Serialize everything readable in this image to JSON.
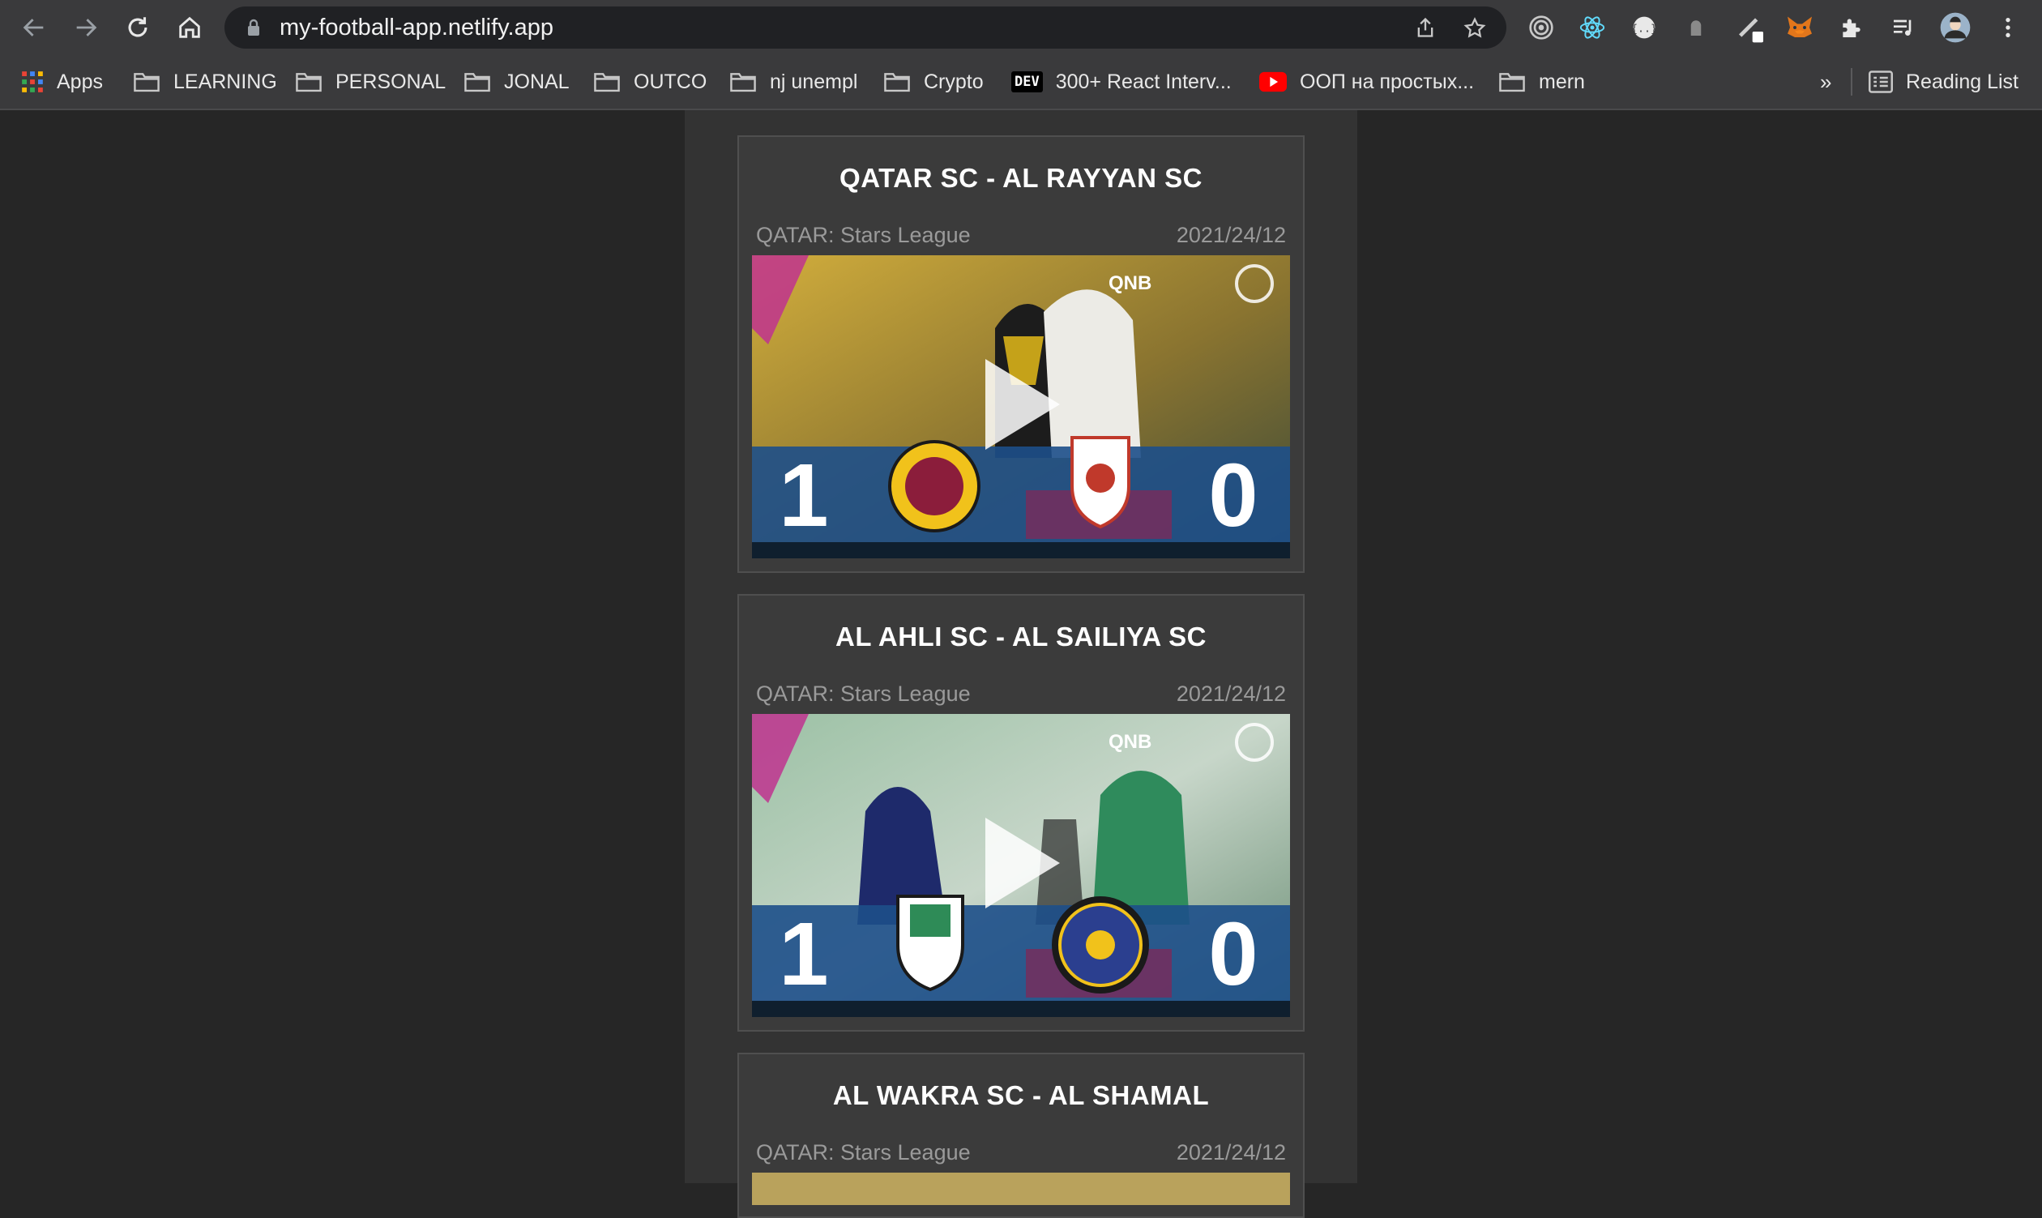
{
  "browser": {
    "url": "my-football-app.netlify.app",
    "bookmarks": [
      "Apps",
      "LEARNING",
      "PERSONAL",
      "JONAL",
      "OUTCO",
      "nj unempl",
      "Crypto",
      "300+ React Interv...",
      "ООП на простых...",
      "mern"
    ],
    "overflow": "»",
    "reading_list": "Reading List",
    "dev_badge": "DEV"
  },
  "matches": [
    {
      "title": "QATAR SC - AL RAYYAN SC",
      "league": "QATAR: Stars League",
      "date": "2021/24/12",
      "home_score": "1",
      "away_score": "0",
      "sponsor": "QNB",
      "bg_colors": [
        "#b8962a",
        "#e6e0d2"
      ]
    },
    {
      "title": "AL AHLI SC - AL SAILIYA SC",
      "league": "QATAR: Stars League",
      "date": "2021/24/12",
      "home_score": "1",
      "away_score": "0",
      "sponsor": "QNB",
      "bg_colors": [
        "#7fa98c",
        "#c9d9cc"
      ]
    },
    {
      "title": "AL WAKRA SC - AL SHAMAL",
      "league": "QATAR: Stars League",
      "date": "2021/24/12"
    }
  ]
}
